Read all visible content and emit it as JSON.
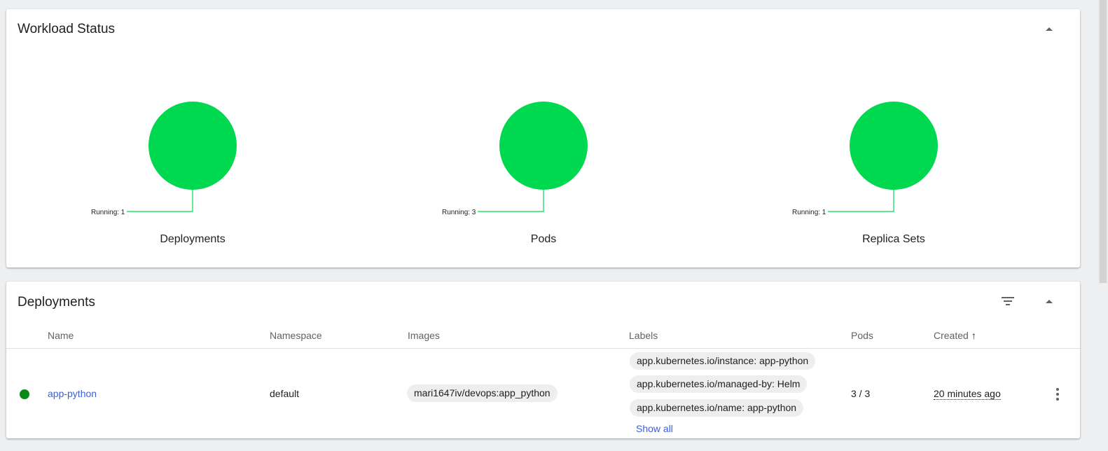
{
  "workload_status": {
    "title": "Workload Status",
    "charts": [
      {
        "name": "Deployments",
        "running_label": "Running: 1",
        "running": 1,
        "color": "#00d94f"
      },
      {
        "name": "Pods",
        "running_label": "Running: 3",
        "running": 3,
        "color": "#00d94f"
      },
      {
        "name": "Replica Sets",
        "running_label": "Running: 1",
        "running": 1,
        "color": "#00d94f"
      }
    ],
    "collapse_icon": "arrow-drop-up-icon"
  },
  "deployments": {
    "title": "Deployments",
    "filter_icon": "filter-list-icon",
    "collapse_icon": "arrow-drop-up-icon",
    "columns": {
      "name": "Name",
      "namespace": "Namespace",
      "images": "Images",
      "labels": "Labels",
      "pods": "Pods",
      "created": "Created",
      "created_sort_icon": "↑"
    },
    "rows": [
      {
        "status_color": "#0a8a12",
        "name": "app-python",
        "namespace": "default",
        "image": "mari1647iv/devops:app_python",
        "labels": [
          "app.kubernetes.io/instance: app-python",
          "app.kubernetes.io/managed-by: Helm",
          "app.kubernetes.io/name: app-python"
        ],
        "show_all": "Show all",
        "pods": "3 / 3",
        "created": "20 minutes ago"
      }
    ]
  },
  "colors": {
    "accent_link": "#3c5fd6",
    "running_green": "#00d94f"
  }
}
